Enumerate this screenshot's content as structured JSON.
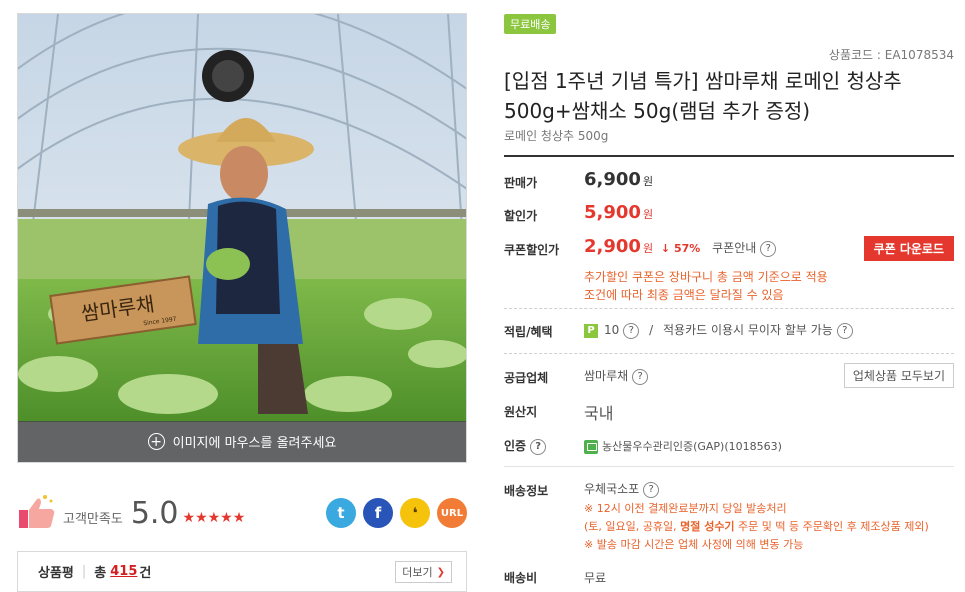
{
  "image": {
    "hover_text": "이미지에 마우스를 올려주세요",
    "sign_text": "쌈마루채",
    "sign_sub": "Since 1997"
  },
  "rating": {
    "label": "고객만족도",
    "score": "5.0",
    "stars": "★★★★★",
    "star_count": 5
  },
  "share": {
    "twitter_icon": "twitter-icon",
    "facebook_icon": "facebook-icon",
    "kakaostory_icon": "kakaostory-icon",
    "url_label": "URL"
  },
  "review": {
    "title": "상품평",
    "separator": "|",
    "total_label": "총",
    "count": "415",
    "unit": "건",
    "more_label": "더보기"
  },
  "product": {
    "free_ship_badge": "무료배송",
    "code": "상품코드 : EA1078534",
    "title": "[입점 1주년 기념 특가] 쌈마루채 로메인 청상추 500g+쌈채소 50g(램덤 추가 증정)",
    "subtitle": "로메인 청상추 500g"
  },
  "price": {
    "sale_label": "판매가",
    "sale_value": "6,900",
    "discount_label": "할인가",
    "discount_value": "5,900",
    "coupon_label": "쿠폰할인가",
    "coupon_value": "2,900",
    "won": "원",
    "discount_pct": "57%",
    "coupon_guide": "쿠폰안내",
    "coupon_button": "쿠폰 다운로드",
    "coupon_note_1": "추가할인 쿠폰은 장바구니 총 금액 기준으로 적용",
    "coupon_note_2": "조건에 따라 최종 금액은 달라질 수 있음"
  },
  "benefit": {
    "label": "적립/혜택",
    "point_badge": "P",
    "point_value": "10",
    "slash": "/",
    "card_text": "적용카드 이용시 무이자 할부 가능"
  },
  "supplier": {
    "label": "공급업체",
    "value": "쌈마루채",
    "button": "업체상품 모두보기"
  },
  "origin": {
    "label": "원산지",
    "value": "국내"
  },
  "cert": {
    "label": "인증",
    "value": "농산물우수관리인증(GAP)(1018563)"
  },
  "shipping": {
    "label": "배송정보",
    "method": "우체국소포",
    "note_1": "※ 12시 이전 결제완료분까지 당일 발송처리",
    "note_2_pre": "(토, 일요일, 공휴일, ",
    "note_2_bold": "명절 성수기",
    "note_2_post": " 주문 및 떡 등 주문확인 후 제조상품 제외)",
    "note_3": "※ 발송 마감 시간은 업체 사정에 의해 변동 가능"
  },
  "shipping_fee": {
    "label": "배송비",
    "value": "무료"
  },
  "question_mark": "?",
  "colors": {
    "accent_red": "#e4382e",
    "note_orange": "#e8632c",
    "badge_green": "#8cc63f"
  }
}
